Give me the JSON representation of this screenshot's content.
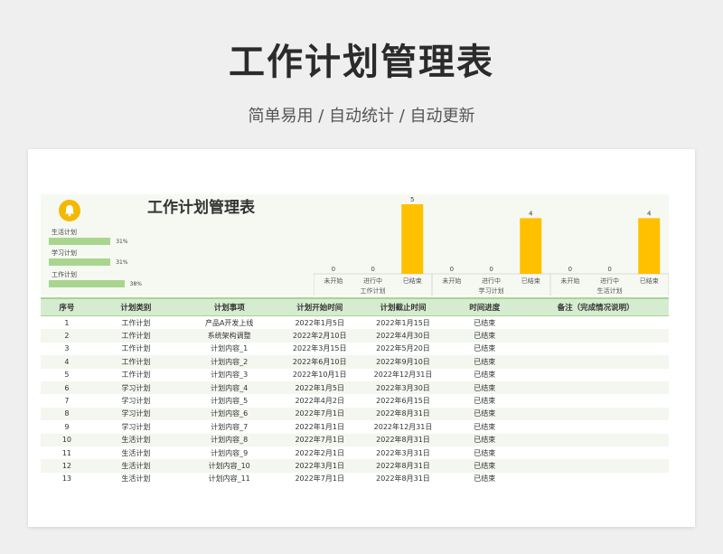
{
  "page": {
    "title": "工作计划管理表",
    "subtitle": "简单易用  /  自动统计  /  自动更新"
  },
  "sheet": {
    "title": "工作计划管理表",
    "progress": [
      {
        "label": "生活计划",
        "value": "31%",
        "fraction": 0.31
      },
      {
        "label": "学习计划",
        "value": "31%",
        "fraction": 0.31
      },
      {
        "label": "工作计划",
        "value": "38%",
        "fraction": 0.38
      }
    ]
  },
  "chart_data": {
    "type": "bar",
    "groups": [
      "工作计划",
      "学习计划",
      "生活计划"
    ],
    "categories": [
      "未开始",
      "进行中",
      "已结束"
    ],
    "values": [
      [
        0,
        0,
        5
      ],
      [
        0,
        0,
        4
      ],
      [
        0,
        0,
        4
      ]
    ],
    "ylim": [
      0,
      5
    ],
    "bar_color": "#ffc000",
    "grid": false,
    "legend": "none"
  },
  "table": {
    "headers": [
      "序号",
      "计划类别",
      "计划事项",
      "计划开始时间",
      "计划截止时间",
      "时间进度",
      "备注（完成情况说明）"
    ],
    "rows": [
      [
        "1",
        "工作计划",
        "产品A开发上线",
        "2022年1月5日",
        "2022年1月15日",
        "已结束",
        ""
      ],
      [
        "2",
        "工作计划",
        "系统架构调整",
        "2022年2月10日",
        "2022年4月30日",
        "已结束",
        ""
      ],
      [
        "3",
        "工作计划",
        "计划内容_1",
        "2022年3月15日",
        "2022年5月20日",
        "已结束",
        ""
      ],
      [
        "4",
        "工作计划",
        "计划内容_2",
        "2022年6月10日",
        "2022年9月10日",
        "已结束",
        ""
      ],
      [
        "5",
        "工作计划",
        "计划内容_3",
        "2022年10月1日",
        "2022年12月31日",
        "已结束",
        ""
      ],
      [
        "6",
        "学习计划",
        "计划内容_4",
        "2022年1月5日",
        "2022年3月30日",
        "已结束",
        ""
      ],
      [
        "7",
        "学习计划",
        "计划内容_5",
        "2022年4月2日",
        "2022年6月15日",
        "已结束",
        ""
      ],
      [
        "8",
        "学习计划",
        "计划内容_6",
        "2022年7月1日",
        "2022年8月31日",
        "已结束",
        ""
      ],
      [
        "9",
        "学习计划",
        "计划内容_7",
        "2022年1月1日",
        "2022年12月31日",
        "已结束",
        ""
      ],
      [
        "10",
        "生活计划",
        "计划内容_8",
        "2022年7月1日",
        "2022年8月31日",
        "已结束",
        ""
      ],
      [
        "11",
        "生活计划",
        "计划内容_9",
        "2022年2月1日",
        "2022年3月31日",
        "已结束",
        ""
      ],
      [
        "12",
        "生活计划",
        "计划内容_10",
        "2022年3月1日",
        "2022年8月31日",
        "已结束",
        ""
      ],
      [
        "13",
        "生活计划",
        "计划内容_11",
        "2022年7月1日",
        "2022年8月31日",
        "已结束",
        ""
      ]
    ]
  }
}
